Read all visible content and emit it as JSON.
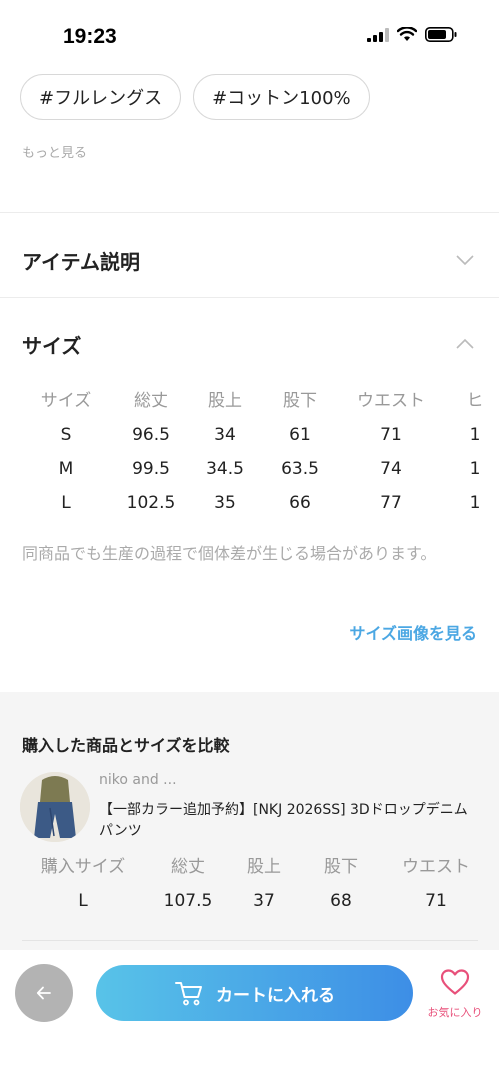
{
  "status_bar": {
    "time": "19:23"
  },
  "tags": [
    "#フルレングス",
    "#コットン100%"
  ],
  "more_link": "もっと見る",
  "item_description": {
    "title": "アイテム説明"
  },
  "size_section": {
    "title": "サイズ",
    "headers": [
      "サイズ",
      "総丈",
      "股上",
      "股下",
      "ウエスト",
      "ヒ"
    ],
    "rows": [
      [
        "S",
        "96.5",
        "34",
        "61",
        "71",
        "1"
      ],
      [
        "M",
        "99.5",
        "34.5",
        "63.5",
        "74",
        "1"
      ],
      [
        "L",
        "102.5",
        "35",
        "66",
        "77",
        "1"
      ]
    ],
    "note": "同商品でも生産の過程で個体差が生じる場合があります。",
    "size_image_link": "サイズ画像を見る"
  },
  "compare": {
    "title": "購入した商品とサイズを比較",
    "brand": "niko and ...",
    "product_name": "【一部カラー追加予約】[NKJ 2026SS] 3Dドロップデニムパンツ",
    "headers": [
      "購入サイズ",
      "総丈",
      "股上",
      "股下",
      "ウエスト"
    ],
    "row": [
      "L",
      "107.5",
      "37",
      "68",
      "71"
    ]
  },
  "bottom_bar": {
    "cart_label": "カートに入れる",
    "favorite_label": "お気に入り"
  },
  "colors": {
    "accent_blue": "#4ba7e3",
    "favorite_pink": "#e8507a"
  }
}
